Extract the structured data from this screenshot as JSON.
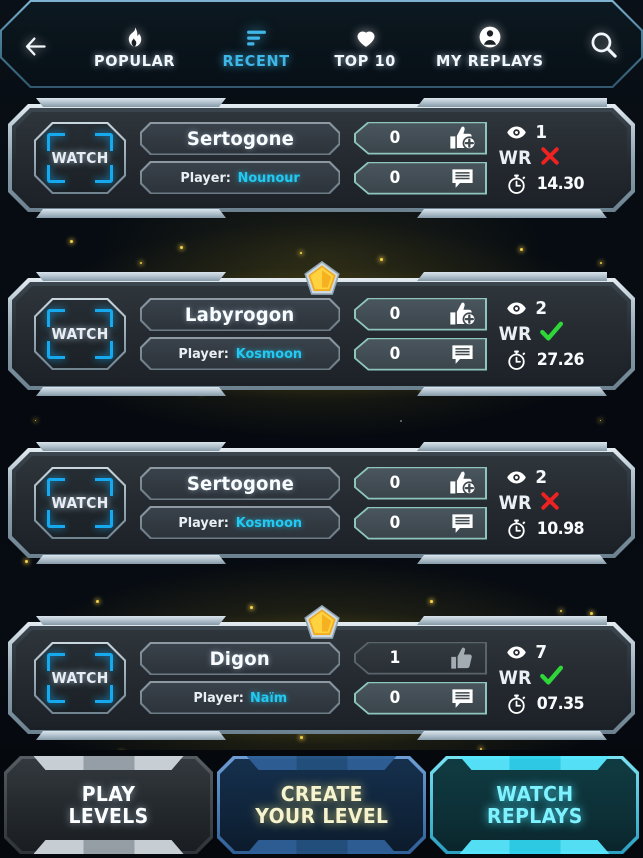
{
  "header": {
    "back_icon": "arrow-left-icon",
    "search_icon": "search-icon",
    "tabs": [
      {
        "label": "POPULAR",
        "icon": "flame-icon",
        "active": false
      },
      {
        "label": "RECENT",
        "icon": "sort-icon",
        "active": true
      },
      {
        "label": "TOP 10",
        "icon": "heart-icon",
        "active": false
      },
      {
        "label": "MY REPLAYS",
        "icon": "person-icon",
        "active": false
      }
    ]
  },
  "colors": {
    "accent_cyan": "#22c9f2",
    "active_tab": "#3fb6e8",
    "teal_border": "#8ec6bd",
    "gold": "#f4c433",
    "wr_yes": "#2fd63a",
    "wr_no": "#ef2222"
  },
  "labels": {
    "watch": "WATCH",
    "player_prefix": "Player:",
    "wr": "WR"
  },
  "replays": [
    {
      "level_name": "Sertogone",
      "player": "Nounour",
      "likes": "0",
      "liked": false,
      "comments": "0",
      "views": "1",
      "world_record": false,
      "time": "14.30",
      "featured": false
    },
    {
      "level_name": "Labyrogon",
      "player": "Kosmoon",
      "likes": "0",
      "liked": false,
      "comments": "0",
      "views": "2",
      "world_record": true,
      "time": "27.26",
      "featured": true
    },
    {
      "level_name": "Sertogone",
      "player": "Kosmoon",
      "likes": "0",
      "liked": false,
      "comments": "0",
      "views": "2",
      "world_record": false,
      "time": "10.98",
      "featured": false
    },
    {
      "level_name": "Digon",
      "player": "Naïm",
      "likes": "1",
      "liked": true,
      "comments": "0",
      "views": "7",
      "world_record": true,
      "time": "07.35",
      "featured": true
    }
  ],
  "bottom_nav": [
    {
      "line1": "PLAY",
      "line2": "LEVELS",
      "kind": "play"
    },
    {
      "line1": "CREATE",
      "line2": "YOUR LEVEL",
      "kind": "create"
    },
    {
      "line1": "WATCH",
      "line2": "REPLAYS",
      "kind": "watchr"
    }
  ]
}
